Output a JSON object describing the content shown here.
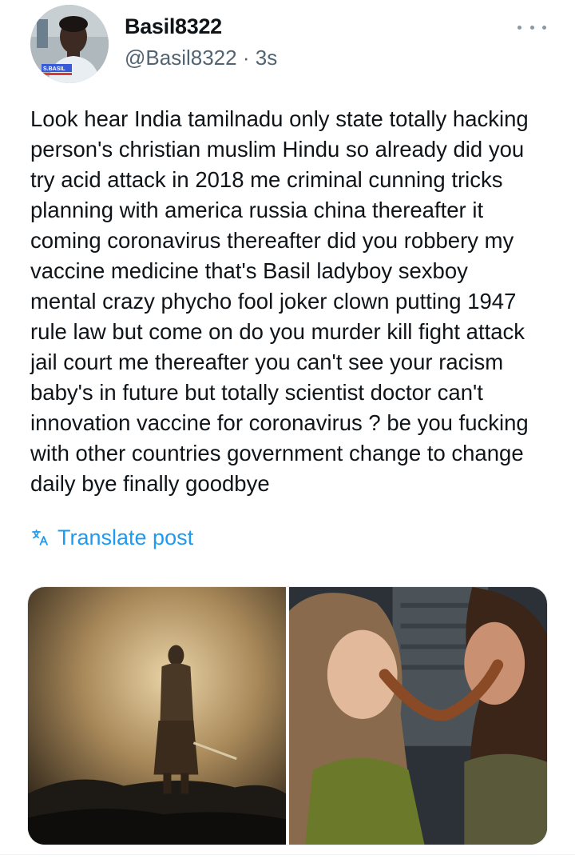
{
  "user": {
    "display_name": "Basil8322",
    "handle": "@Basil8322",
    "separator": "·",
    "time": "3s",
    "avatar_caption": "S.BASIL"
  },
  "post": {
    "lines": [
      "Look hear India tamilnadu only state totally hacking",
      "person's christian muslim Hindu so already did you",
      "try acid attack in 2018 me criminal cunning tricks",
      "planning with america russia china thereafter it",
      "coming coronavirus thereafter did you robbery my",
      "vaccine medicine that's Basil ladyboy sexboy",
      "mental crazy phycho fool joker clown putting 1947",
      "rule law but come on do you murder kill fight attack",
      "jail court me thereafter you can't see your racism",
      "baby's in future but totally scientist doctor can't",
      "innovation vaccine for coronavirus ? be you fucking",
      "with other countries government change to change",
      "daily bye finally goodbye"
    ],
    "translate_label": "Translate post"
  },
  "icons": {
    "more": "more-dots-icon",
    "translate": "translate-icon"
  },
  "colors": {
    "text": "#0f1419",
    "secondary": "#536471",
    "link": "#1d9bf0"
  }
}
